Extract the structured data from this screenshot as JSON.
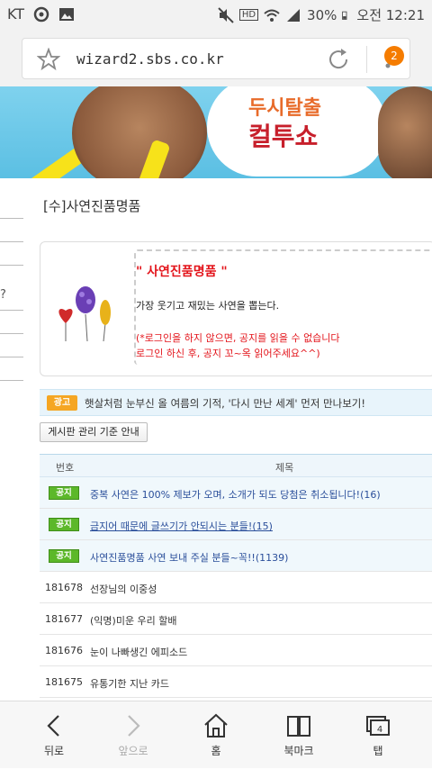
{
  "status_bar": {
    "carrier": "KT",
    "battery": "30%",
    "time": "오전 12:21",
    "network_label": "HD"
  },
  "browser": {
    "url": "wizard2.sbs.co.kr",
    "tabs_badge": "2"
  },
  "banner": {
    "logo_line1": "두시탈출",
    "logo_line2": "컬투쇼"
  },
  "board": {
    "title": "[수]사연진품명품"
  },
  "notice": {
    "title": "\" 사연진품명품 \"",
    "desc": "가장 웃기고 재밌는 사연을 뽑는다.",
    "warn1": "(*로그인을 하지 않으면, 공지를 읽을 수 없습니다",
    "warn2": "로그인 하신 후, 공지 꼬~옥 읽어주세요^^)"
  },
  "ad": {
    "tag": "광고",
    "text": "햇살처럼 눈부신 올 여름의 기적, '다시 만난 세계' 먼저 만나보기!"
  },
  "guide_button": "게시판 관리 기준 안내",
  "table": {
    "headers": {
      "num": "번호",
      "title": "제목"
    },
    "notice_rows": [
      {
        "tag": "공지",
        "title": "중복 사연은 100% 제보가 오며, 소개가 되도 당첨은 취소됩니다!(16)"
      },
      {
        "tag": "공지",
        "title": "금지어 때문에 글쓰기가 안되시는 분들!(15)"
      },
      {
        "tag": "공지",
        "title": "사연진품명품 사연 보내 주실 분들~꼭!!(1139)"
      }
    ],
    "rows": [
      {
        "num": "181678",
        "title": "선장님의 이중성"
      },
      {
        "num": "181677",
        "title": "(익명)미운 우리 할배"
      },
      {
        "num": "181676",
        "title": "눈이 나빠생긴 에피소드"
      },
      {
        "num": "181675",
        "title": "유통기한 지난 카드"
      }
    ]
  },
  "bottom_nav": {
    "back": "뒤로",
    "forward": "앞으로",
    "home": "홈",
    "bookmarks": "북마크",
    "tabs": "탭",
    "tabs_count": "4"
  }
}
